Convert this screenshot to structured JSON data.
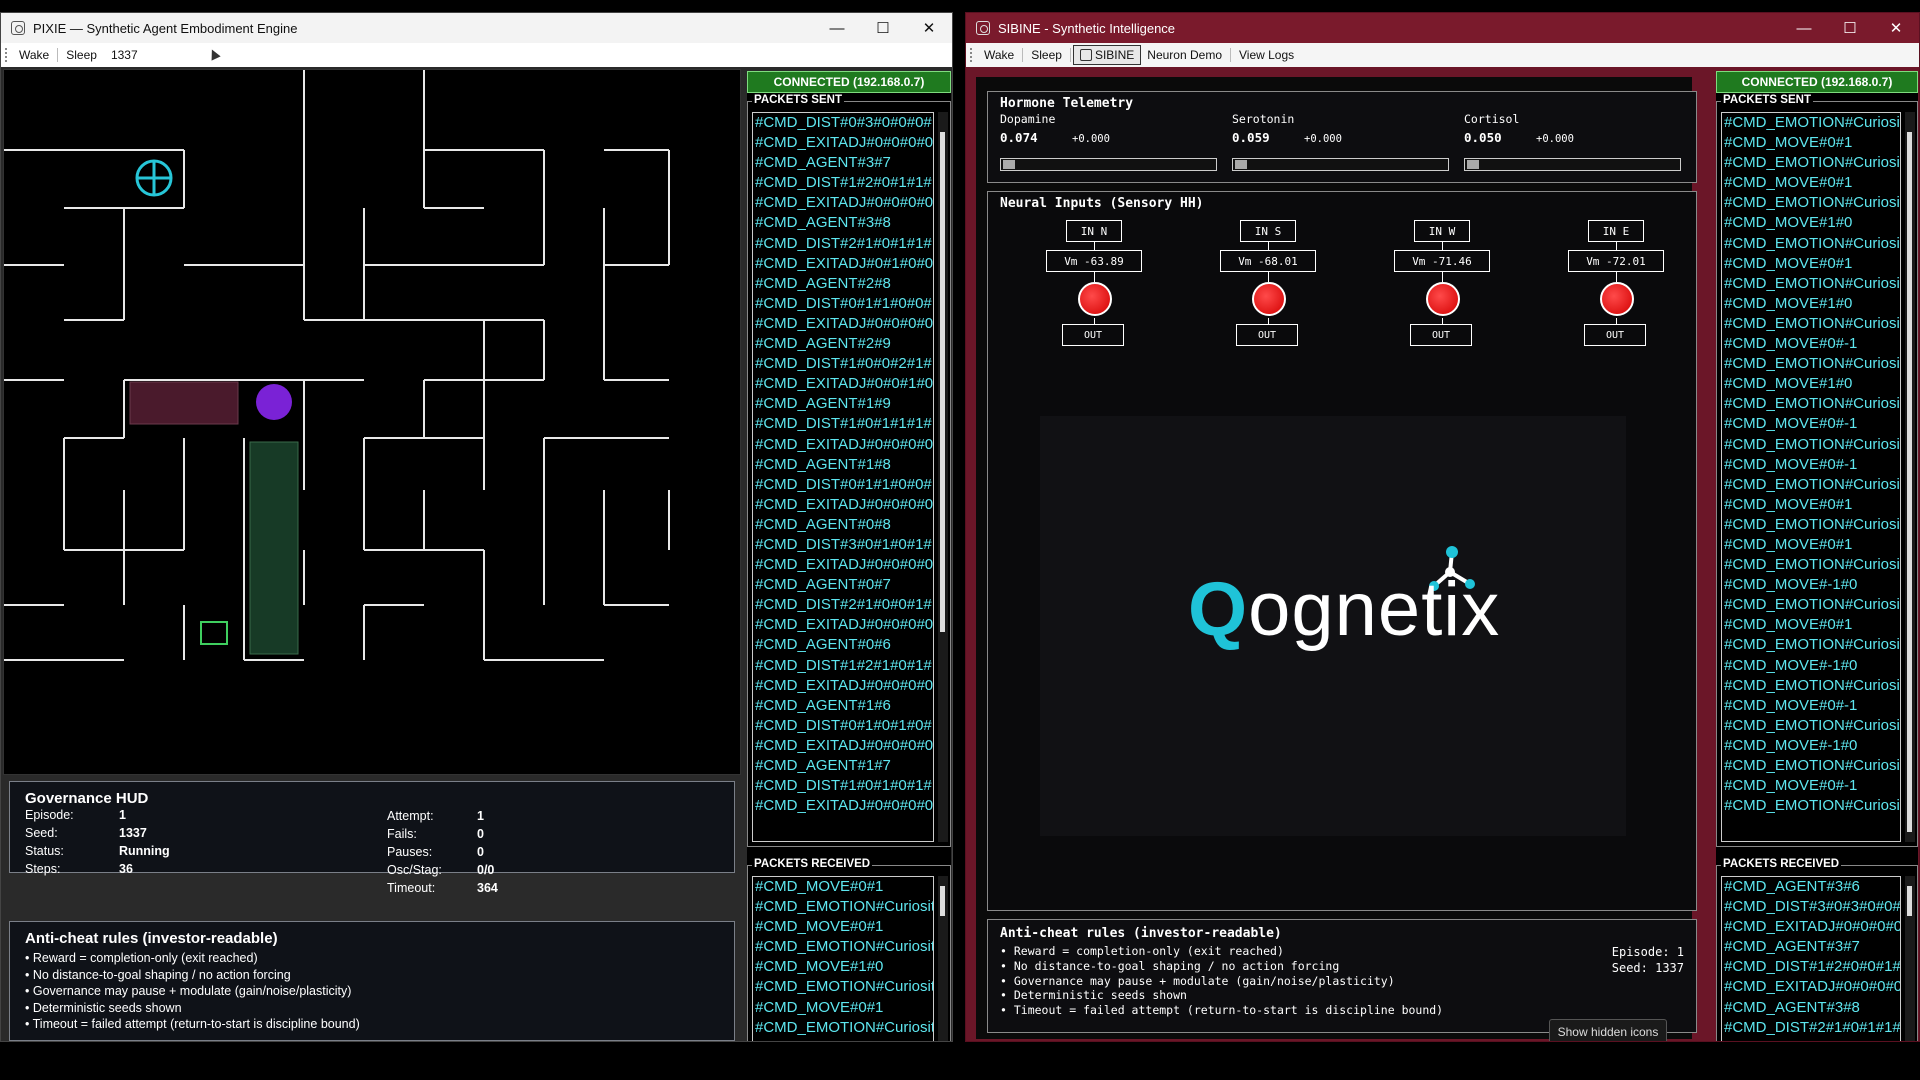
{
  "pixie": {
    "title": "PIXIE — Synthetic Agent Embodiment Engine",
    "menu": {
      "wake": "Wake",
      "sleep": "Sleep",
      "seed": "1337"
    },
    "hud": {
      "title": "Governance HUD",
      "left": [
        {
          "k": "Episode:",
          "v": "1"
        },
        {
          "k": "Seed:",
          "v": "1337"
        },
        {
          "k": "Status:",
          "v": "Running"
        },
        {
          "k": "Steps:",
          "v": "36"
        }
      ],
      "right": [
        {
          "k": "Attempt:",
          "v": "1"
        },
        {
          "k": "Fails:",
          "v": "0"
        },
        {
          "k": "Pauses:",
          "v": "0"
        },
        {
          "k": "Osc/Stag:",
          "v": "0/0"
        },
        {
          "k": "Timeout:",
          "v": "364"
        }
      ]
    },
    "rules": {
      "title": "Anti-cheat rules (investor-readable)",
      "items": [
        "• Reward = completion-only (exit reached)",
        "• No distance-to-goal shaping / no action forcing",
        "• Governance may pause + modulate (gain/noise/plasticity)",
        "• Deterministic seeds shown",
        "• Timeout = failed attempt (return-to-start is discipline bound)"
      ]
    },
    "conn": "CONNECTED (192.168.0.7)",
    "sent_label": "PACKETS SENT",
    "recv_label": "PACKETS RECEIVED",
    "sent": [
      "#CMD_DIST#0#3#0#0#0#",
      "#CMD_EXITADJ#0#0#0#0#",
      "#CMD_AGENT#3#7",
      "#CMD_DIST#1#2#0#1#1#",
      "#CMD_EXITADJ#0#0#0#0#",
      "#CMD_AGENT#3#8",
      "#CMD_DIST#2#1#0#1#1#",
      "#CMD_EXITADJ#0#1#0#0#",
      "#CMD_AGENT#2#8",
      "#CMD_DIST#0#1#1#0#0#",
      "#CMD_EXITADJ#0#0#0#0#",
      "#CMD_AGENT#2#9",
      "#CMD_DIST#1#0#0#2#1#",
      "#CMD_EXITADJ#0#0#1#0#",
      "#CMD_AGENT#1#9",
      "#CMD_DIST#1#0#1#1#1#",
      "#CMD_EXITADJ#0#0#0#0#",
      "#CMD_AGENT#1#8",
      "#CMD_DIST#0#1#1#0#0#",
      "#CMD_EXITADJ#0#0#0#0#",
      "#CMD_AGENT#0#8",
      "#CMD_DIST#3#0#1#0#1#",
      "#CMD_EXITADJ#0#0#0#0#",
      "#CMD_AGENT#0#7",
      "#CMD_DIST#2#1#0#0#1#",
      "#CMD_EXITADJ#0#0#0#0#",
      "#CMD_AGENT#0#6",
      "#CMD_DIST#1#2#1#0#1#",
      "#CMD_EXITADJ#0#0#0#0#",
      "#CMD_AGENT#1#6",
      "#CMD_DIST#0#1#0#1#0#",
      "#CMD_EXITADJ#0#0#0#0#",
      "#CMD_AGENT#1#7",
      "#CMD_DIST#1#0#1#0#1#",
      "#CMD_EXITADJ#0#0#0#0#"
    ],
    "recv": [
      "#CMD_MOVE#0#1",
      "#CMD_EMOTION#Curiosit",
      "#CMD_MOVE#0#1",
      "#CMD_EMOTION#Curiosit",
      "#CMD_MOVE#1#0",
      "#CMD_EMOTION#Curiosit",
      "#CMD_MOVE#0#1",
      "#CMD_EMOTION#Curiosit"
    ]
  },
  "sibine": {
    "title": "SIBINE - Synthetic Intelligence",
    "menu": {
      "wake": "Wake",
      "sleep": "Sleep",
      "sibine": "SIBINE",
      "neuron_demo": "Neuron Demo",
      "view_logs": "View Logs"
    },
    "hormones": {
      "title": "Hormone Telemetry",
      "items": [
        {
          "name": "Dopamine",
          "value": "0.074",
          "delta": "+0.000"
        },
        {
          "name": "Serotonin",
          "value": "0.059",
          "delta": "+0.000"
        },
        {
          "name": "Cortisol",
          "value": "0.050",
          "delta": "+0.000"
        }
      ]
    },
    "neural": {
      "title": "Neural Inputs (Sensory HH)",
      "neurons": [
        {
          "in": "IN N",
          "vm": "Vm -63.89",
          "out": "OUT"
        },
        {
          "in": "IN S",
          "vm": "Vm -68.01",
          "out": "OUT"
        },
        {
          "in": "IN W",
          "vm": "Vm -71.46",
          "out": "OUT"
        },
        {
          "in": "IN E",
          "vm": "Vm -72.01",
          "out": "OUT"
        }
      ]
    },
    "logo": {
      "q": "Q",
      "rest": "ognetix"
    },
    "rules": {
      "title": "Anti-cheat rules (investor-readable)",
      "items": [
        "• Reward = completion-only (exit reached)",
        "• No distance-to-goal shaping / no action forcing",
        "• Governance may pause + modulate (gain/noise/plasticity)",
        "• Deterministic seeds shown",
        "• Timeout = failed attempt (return-to-start is discipline bound)"
      ],
      "episode": "Episode: 1",
      "seed": "Seed: 1337"
    },
    "show_hidden": "Show hidden icons",
    "conn": "CONNECTED (192.168.0.7)",
    "sent_label": "PACKETS SENT",
    "recv_label": "PACKETS RECEIVED",
    "sent": [
      "#CMD_EMOTION#Curiosit",
      "#CMD_MOVE#0#1",
      "#CMD_EMOTION#Curiosit",
      "#CMD_MOVE#0#1",
      "#CMD_EMOTION#Curiosit",
      "#CMD_MOVE#1#0",
      "#CMD_EMOTION#Curiosit",
      "#CMD_MOVE#0#1",
      "#CMD_EMOTION#Curiosit",
      "#CMD_MOVE#1#0",
      "#CMD_EMOTION#Curiosit",
      "#CMD_MOVE#0#-1",
      "#CMD_EMOTION#Curiosit",
      "#CMD_MOVE#1#0",
      "#CMD_EMOTION#Curiosit",
      "#CMD_MOVE#0#-1",
      "#CMD_EMOTION#Curiosit",
      "#CMD_MOVE#0#-1",
      "#CMD_EMOTION#Curiosit",
      "#CMD_MOVE#0#1",
      "#CMD_EMOTION#Curiosit",
      "#CMD_MOVE#0#1",
      "#CMD_EMOTION#Curiosit",
      "#CMD_MOVE#-1#0",
      "#CMD_EMOTION#Curiosit",
      "#CMD_MOVE#0#1",
      "#CMD_EMOTION#Curiosit",
      "#CMD_MOVE#-1#0",
      "#CMD_EMOTION#Curiosit",
      "#CMD_MOVE#0#-1",
      "#CMD_EMOTION#Curiosit",
      "#CMD_MOVE#-1#0",
      "#CMD_EMOTION#Curiosit",
      "#CMD_MOVE#0#-1",
      "#CMD_EMOTION#Curiosit"
    ],
    "recv": [
      "#CMD_AGENT#3#6",
      "#CMD_DIST#3#0#3#0#0#",
      "#CMD_EXITADJ#0#0#0#0#",
      "#CMD_AGENT#3#7",
      "#CMD_DIST#1#2#0#0#1#",
      "#CMD_EXITADJ#0#0#0#0#",
      "#CMD_AGENT#3#8",
      "#CMD_DIST#2#1#0#1#1#"
    ]
  }
}
